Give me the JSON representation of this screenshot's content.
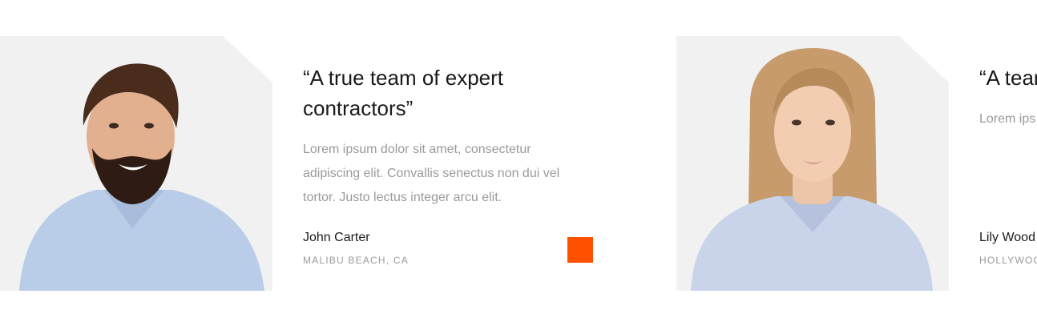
{
  "accent_color": "#ff5000",
  "testimonials": [
    {
      "quote": "“A true team of expert contractors”",
      "text": "Lorem ipsum dolor sit amet, consectetur adipiscing elit. Convallis senectus non dui vel tortor. Justo lectus integer arcu elit.",
      "author": "John Carter",
      "location": "MALIBU BEACH, CA"
    },
    {
      "quote": "“A team undeli",
      "text": "Lorem ips adipiscing tortor. Ju",
      "author": "Lily Wood",
      "location": "HOLLYWOO"
    }
  ]
}
